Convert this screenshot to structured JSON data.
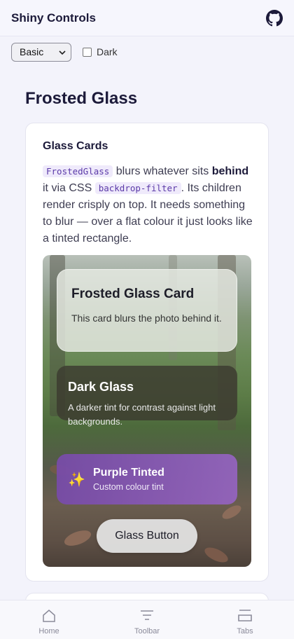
{
  "header": {
    "title": "Shiny Controls",
    "github_icon": "github-icon"
  },
  "controls": {
    "style_select": {
      "value": "Basic",
      "options": [
        "Basic"
      ]
    },
    "dark_toggle": {
      "label": "Dark",
      "checked": false
    }
  },
  "section": {
    "title": "Frosted Glass"
  },
  "card": {
    "title": "Glass Cards",
    "description": {
      "code1": "FrostedGlass",
      "part1": " blurs whatever sits ",
      "bold": "behind",
      "part2": " it via CSS ",
      "code2": "backdrop-filter",
      "part3": ". Its children render crisply on top. It needs something to blur — over a flat colour it just looks like a tinted rectangle."
    }
  },
  "demo": {
    "frosted": {
      "title": "Frosted Glass Card",
      "text": "This card blurs the photo behind it."
    },
    "dark": {
      "title": "Dark Glass",
      "text": "A darker tint for contrast against light backgrounds."
    },
    "purple": {
      "icon": "sparkles-icon",
      "title": "Purple Tinted",
      "subtitle": "Custom colour tint"
    },
    "button": {
      "label": "Glass Button"
    }
  },
  "tabs": [
    {
      "label": "Home",
      "icon": "home-icon"
    },
    {
      "label": "Toolbar",
      "icon": "toolbar-icon"
    },
    {
      "label": "Tabs",
      "icon": "tabs-icon"
    }
  ],
  "colors": {
    "accent": "#5b3aa8",
    "title": "#1c1a3a",
    "purple": "#8a5bc0"
  }
}
